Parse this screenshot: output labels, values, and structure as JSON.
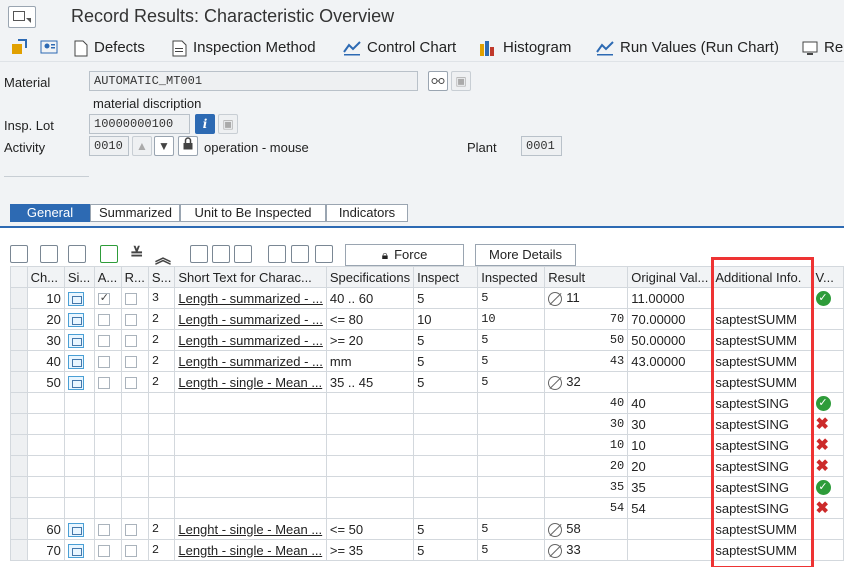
{
  "title": "Record Results: Characteristic Overview",
  "toolbar": {
    "defects": "Defects",
    "inspection_method": "Inspection Method",
    "control_chart": "Control Chart",
    "histogram": "Histogram",
    "run_values": "Run Values (Run Chart)",
    "more": "Re"
  },
  "header": {
    "material_label": "Material",
    "material_value": "AUTOMATIC_MT001",
    "material_desc": "material discription",
    "insp_lot_label": "Insp. Lot",
    "insp_lot_value": "10000000100",
    "activity_label": "Activity",
    "activity_value": "0010",
    "activity_desc": "operation - mouse",
    "plant_label": "Plant",
    "plant_value": "0001"
  },
  "tabs": [
    "General",
    "Summarized",
    "Unit to Be Inspected",
    "Indicators"
  ],
  "table_toolbar": {
    "force": "Force",
    "more_details": "More Details"
  },
  "columns": [
    "Ch...",
    "Si...",
    "A...",
    "R...",
    "S...",
    "Short Text for Charac...",
    "Specifications",
    "Inspect",
    "Inspected",
    "Result",
    "Original Val...",
    "Additional Info.",
    "V..."
  ],
  "rows": [
    {
      "ch": "10",
      "a": true,
      "s": "3",
      "text": "Length - summarized - ...",
      "spec": "40 .. 60",
      "inspect": "5",
      "inspected": "5",
      "result": "11",
      "result_valuated": true,
      "orig": "11.00000",
      "info": "",
      "v": "ok"
    },
    {
      "ch": "20",
      "a": false,
      "s": "2",
      "text": "Length - summarized - ...",
      "spec": "<= 80",
      "inspect": "10",
      "inspected": "10",
      "result": "70",
      "result_valuated": false,
      "orig": "70.00000",
      "info": "saptestSUMM",
      "v": ""
    },
    {
      "ch": "30",
      "a": false,
      "s": "2",
      "text": "Length - summarized - ...",
      "spec": ">= 20",
      "inspect": "5",
      "inspected": "5",
      "result": "50",
      "result_valuated": false,
      "orig": "50.00000",
      "info": "saptestSUMM",
      "v": ""
    },
    {
      "ch": "40",
      "a": false,
      "s": "2",
      "text": "Length - summarized - ...",
      "spec": "mm",
      "inspect": "5",
      "inspected": "5",
      "result": "43",
      "result_valuated": false,
      "orig": "43.00000",
      "info": "saptestSUMM",
      "v": ""
    },
    {
      "ch": "50",
      "a": false,
      "s": "2",
      "text": "Length - single - Mean ...",
      "spec": "35 .. 45",
      "inspect": "5",
      "inspected": "5",
      "result": "32",
      "result_valuated": true,
      "orig": "",
      "info": "saptestSUMM",
      "v": ""
    },
    {
      "ch": "",
      "sub": true,
      "result": "40",
      "orig": "40",
      "info": "saptestSING",
      "v": "ok"
    },
    {
      "ch": "",
      "sub": true,
      "result": "30",
      "orig": "30",
      "info": "saptestSING",
      "v": "nok"
    },
    {
      "ch": "",
      "sub": true,
      "result": "10",
      "orig": "10",
      "info": "saptestSING",
      "v": "nok"
    },
    {
      "ch": "",
      "sub": true,
      "result": "20",
      "orig": "20",
      "info": "saptestSING",
      "v": "nok"
    },
    {
      "ch": "",
      "sub": true,
      "result": "35",
      "orig": "35",
      "info": "saptestSING",
      "v": "ok"
    },
    {
      "ch": "",
      "sub": true,
      "result": "54",
      "orig": "54",
      "info": "saptestSING",
      "v": "nok"
    },
    {
      "ch": "60",
      "a": false,
      "s": "2",
      "text": "Lenght - single - Mean ...",
      "spec": "<= 50",
      "inspect": "5",
      "inspected": "5",
      "result": "58",
      "result_valuated": true,
      "orig": "",
      "info": "saptestSUMM",
      "v": ""
    },
    {
      "ch": "70",
      "a": false,
      "s": "2",
      "text": "Length - single - Mean ...",
      "spec": ">= 35",
      "inspect": "5",
      "inspected": "5",
      "result": "33",
      "result_valuated": true,
      "orig": "",
      "info": "saptestSUMM",
      "v": ""
    }
  ]
}
